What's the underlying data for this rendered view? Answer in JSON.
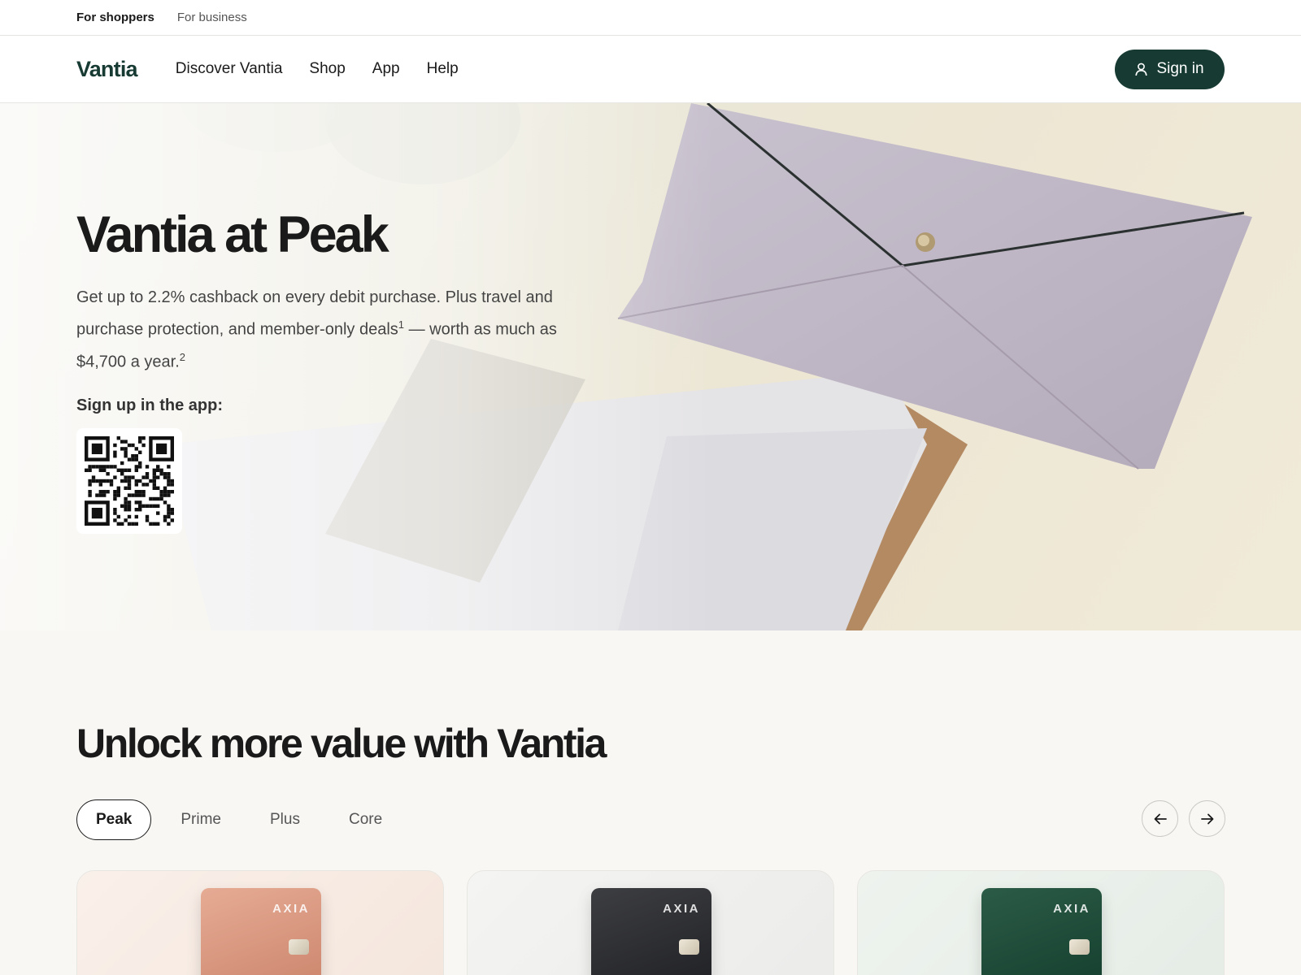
{
  "utility_nav": {
    "shoppers": "For shoppers",
    "business": "For business"
  },
  "nav": {
    "logo": "Vantia",
    "links": [
      "Discover Vantia",
      "Shop",
      "App",
      "Help"
    ],
    "sign_in": "Sign in"
  },
  "hero": {
    "title": "Vantia at Peak",
    "desc_part1": "Get up to 2.2% cashback on every debit purchase. Plus travel and purchase protection, and member-only deals",
    "footnote1": "1",
    "desc_part2": " — worth as much as $4,700 a year.",
    "footnote2": "2",
    "signup_label": "Sign up in the app:"
  },
  "plans": {
    "title": "Unlock more value with Vantia",
    "tabs": [
      "Peak",
      "Prime",
      "Plus",
      "Core"
    ],
    "card_brand": "AXIA"
  }
}
